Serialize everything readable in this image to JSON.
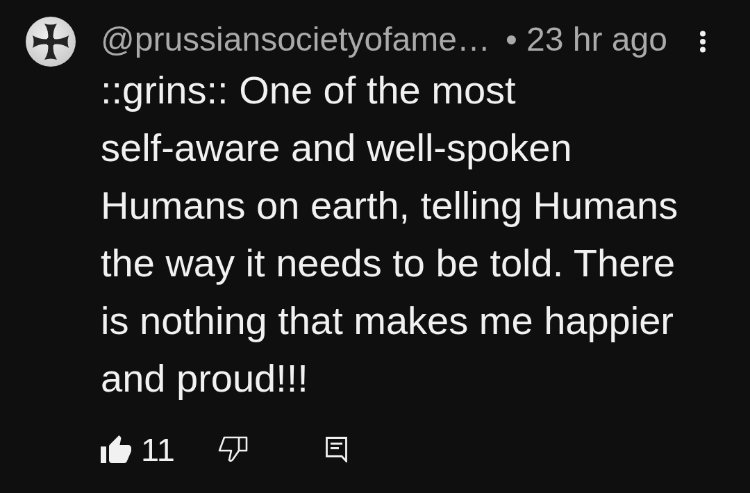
{
  "comment": {
    "author": "@prussiansocietyofame…",
    "time": "• 23 hr ago",
    "text": "::grins:: One of the most self-aware and well-spoken Humans on earth, telling Humans the way it needs to be told. There is nothing that makes me happier and proud!!!"
  },
  "actions": {
    "like_count": "11",
    "liked": true,
    "disliked": false
  }
}
